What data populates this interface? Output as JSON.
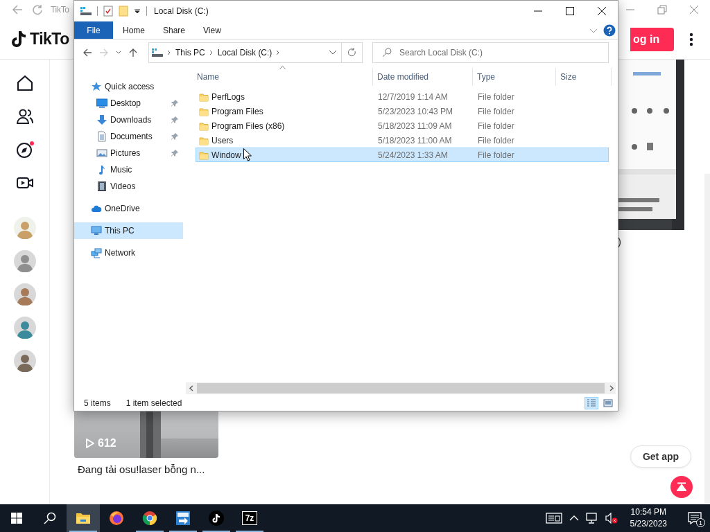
{
  "browser": {
    "tab_title": "TikTo",
    "logo_text": "TikTo",
    "login_button": "og in",
    "video_card": {
      "views": "612",
      "caption": "Đang tải osu!laser bỗng n..."
    },
    "side_text": ")",
    "get_app_button": "Get app"
  },
  "explorer": {
    "title": "Local Disk (C:)",
    "ribbon_tabs": [
      {
        "label": "File",
        "selected": true
      },
      {
        "label": "Home",
        "selected": false
      },
      {
        "label": "Share",
        "selected": false
      },
      {
        "label": "View",
        "selected": false
      }
    ],
    "breadcrumb": [
      "This PC",
      "Local Disk (C:)"
    ],
    "search": {
      "placeholder": "Search Local Disk (C:)"
    },
    "nav_pane": [
      {
        "label": "Quick access",
        "kind": "star",
        "selected": false,
        "children": [
          {
            "label": "Desktop",
            "kind": "desktop",
            "pinned": true,
            "selected": false
          },
          {
            "label": "Downloads",
            "kind": "downloads",
            "pinned": true,
            "selected": false
          },
          {
            "label": "Documents",
            "kind": "documents",
            "pinned": true,
            "selected": false
          },
          {
            "label": "Pictures",
            "kind": "pictures",
            "pinned": true,
            "selected": false
          },
          {
            "label": "Music",
            "kind": "music",
            "pinned": false,
            "selected": false
          },
          {
            "label": "Videos",
            "kind": "videos",
            "pinned": false,
            "selected": false
          }
        ]
      },
      {
        "label": "OneDrive",
        "kind": "cloud",
        "selected": false
      },
      {
        "label": "This PC",
        "kind": "pc",
        "selected": true
      },
      {
        "label": "Network",
        "kind": "network",
        "selected": false
      }
    ],
    "columns": [
      "Name",
      "Date modified",
      "Type",
      "Size"
    ],
    "files": [
      {
        "name": "PerfLogs",
        "date_modified": "12/7/2019 1:14 AM",
        "type": "File folder",
        "selected": false
      },
      {
        "name": "Program Files",
        "date_modified": "5/23/2023 10:43 PM",
        "type": "File folder",
        "selected": false
      },
      {
        "name": "Program Files (x86)",
        "date_modified": "5/18/2023 11:09 AM",
        "type": "File folder",
        "selected": false
      },
      {
        "name": "Users",
        "date_modified": "5/18/2023 11:00 AM",
        "type": "File folder",
        "selected": false
      },
      {
        "name": "Window",
        "date_modified": "5/24/2023 1:33 AM",
        "type": "File folder",
        "selected": true
      }
    ],
    "status_bar": {
      "item_count": "5 items",
      "selection": "1 item selected"
    },
    "views": [
      {
        "kind": "details",
        "selected": true
      },
      {
        "kind": "large-icons",
        "selected": false
      }
    ]
  },
  "taskbar": {
    "apps": [
      {
        "kind": "file-explorer",
        "selected": true,
        "running": true
      },
      {
        "kind": "firefox",
        "selected": false,
        "running": false
      },
      {
        "kind": "chrome",
        "selected": false,
        "running": true
      },
      {
        "kind": "remote",
        "selected": false,
        "running": true
      },
      {
        "kind": "tiktok",
        "selected": false,
        "running": true
      },
      {
        "kind": "archiver",
        "label": "7z",
        "selected": false,
        "running": true
      }
    ],
    "clock": {
      "time": "10:54 PM",
      "date": "5/23/2023"
    },
    "notification_count": "1"
  }
}
